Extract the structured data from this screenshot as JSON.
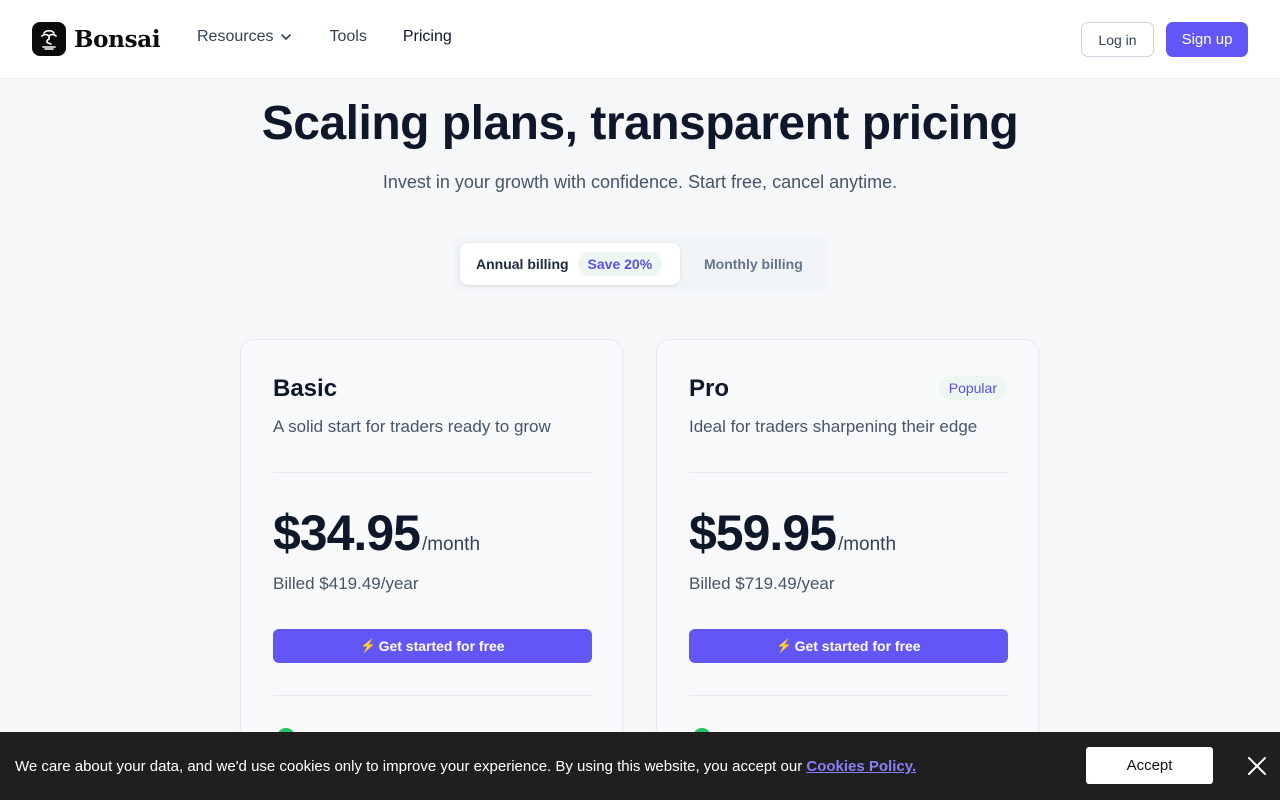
{
  "header": {
    "brand": "Bonsai",
    "nav": [
      {
        "label": "Resources",
        "has_dropdown": true
      },
      {
        "label": "Tools"
      },
      {
        "label": "Pricing",
        "active": true
      }
    ],
    "login_label": "Log in",
    "signup_label": "Sign up"
  },
  "hero": {
    "title": "Scaling plans, transparent pricing",
    "subtitle": "Invest in your growth with confidence. Start free, cancel anytime."
  },
  "billing_toggle": {
    "annual_label": "Annual billing",
    "save_badge": "Save 20%",
    "monthly_label": "Monthly billing",
    "selected": "Annual billing"
  },
  "plans": [
    {
      "name": "Basic",
      "description": "A solid start for traders ready to grow",
      "price": "$34.95",
      "period": "/month",
      "billed": "Billed $419.49/year",
      "cta_icon": "⚡",
      "cta": "Get started for free"
    },
    {
      "name": "Pro",
      "badge": "Popular",
      "description": "Ideal for traders sharpening their edge",
      "price": "$59.95",
      "period": "/month",
      "billed": "Billed $719.49/year",
      "cta_icon": "⚡",
      "cta": "Get started for free"
    }
  ],
  "cookie_banner": {
    "text": "We care about your data, and we'd use cookies only to improve your experience. By using this website, you accept our ",
    "link_label": "Cookies Policy.",
    "accept_label": "Accept"
  },
  "icons": {
    "logo": "bonsai-tree-icon",
    "dropdown": "chevron-down-icon",
    "cta": "lightning-bolt-icon",
    "feature": "check-icon",
    "close": "close-icon"
  },
  "colors": {
    "accent": "#6356f6",
    "page_background": "#f5f7f9",
    "cookie_background": "#1f1f1f",
    "check": "#22c55e"
  }
}
